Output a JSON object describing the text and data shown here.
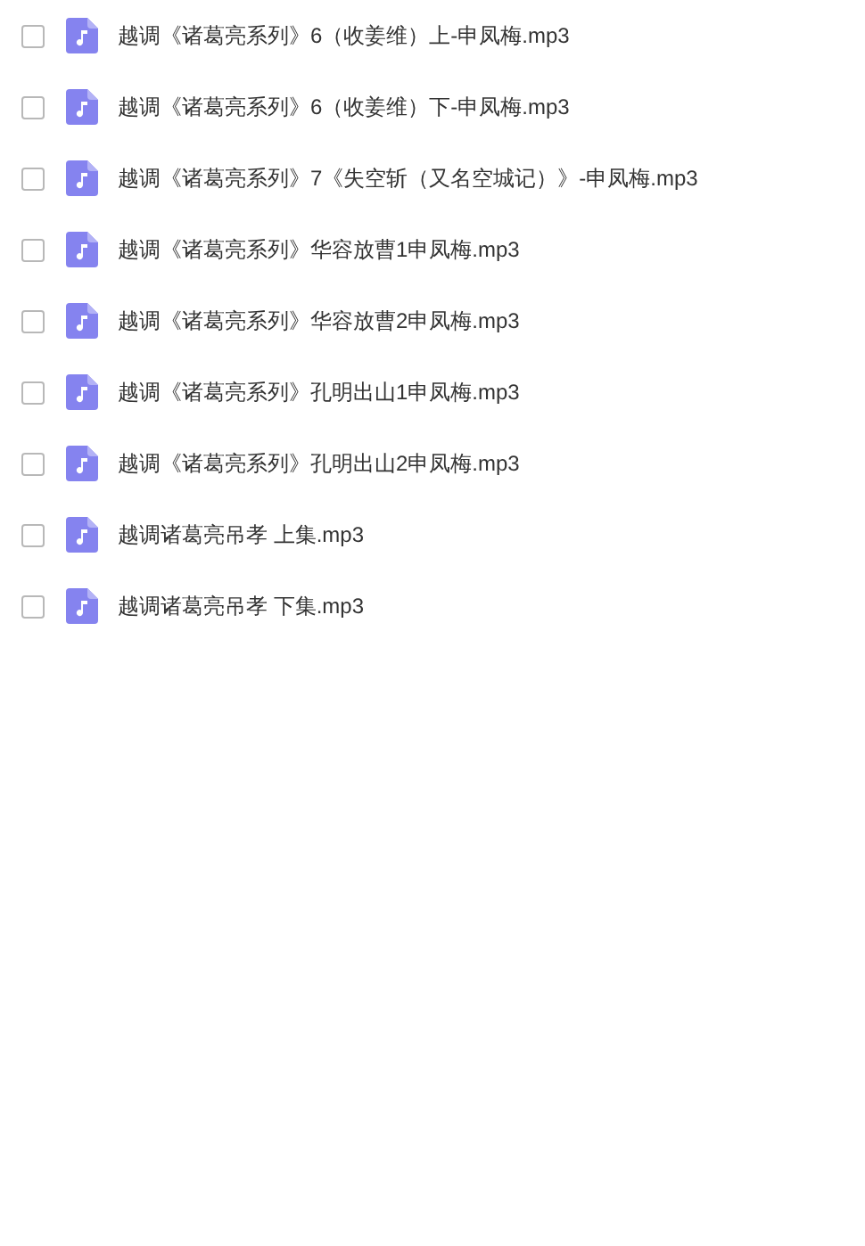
{
  "files": [
    {
      "name": "越调《诸葛亮系列》6（收姜维）上-申凤梅.mp3",
      "checked": false
    },
    {
      "name": "越调《诸葛亮系列》6（收姜维）下-申凤梅.mp3",
      "checked": false
    },
    {
      "name": "越调《诸葛亮系列》7《失空斩（又名空城记）》-申凤梅.mp3",
      "checked": false
    },
    {
      "name": "越调《诸葛亮系列》华容放曹1申凤梅.mp3",
      "checked": false
    },
    {
      "name": "越调《诸葛亮系列》华容放曹2申凤梅.mp3",
      "checked": false
    },
    {
      "name": "越调《诸葛亮系列》孔明出山1申凤梅.mp3",
      "checked": false
    },
    {
      "name": "越调《诸葛亮系列》孔明出山2申凤梅.mp3",
      "checked": false
    },
    {
      "name": "越调诸葛亮吊孝 上集.mp3",
      "checked": false
    },
    {
      "name": "越调诸葛亮吊孝 下集.mp3",
      "checked": false
    }
  ]
}
